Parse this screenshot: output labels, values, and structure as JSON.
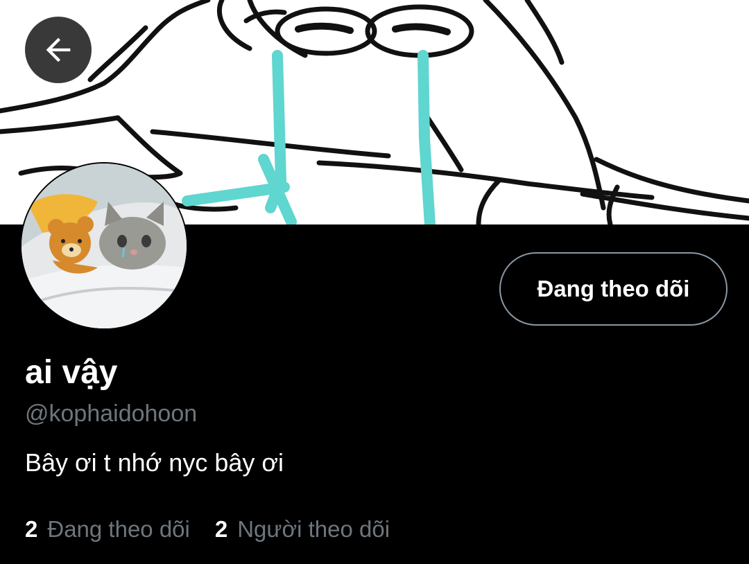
{
  "colors": {
    "background": "#000000",
    "text_primary": "#ffffff",
    "text_secondary": "#6e767d",
    "button_border": "#8b98a5",
    "banner_tears": "#5fd6cf"
  },
  "banner": {
    "icon": "crying-drawing-banner"
  },
  "back_button": {
    "icon": "arrow-left-icon"
  },
  "avatar": {
    "icon": "crying-cat-avatar"
  },
  "follow_button": {
    "label": "Đang theo dõi"
  },
  "profile": {
    "display_name": "ai vậy",
    "handle": "@kophaidohoon",
    "bio": "Bây ơi t nhớ nyc bây ơi"
  },
  "stats": {
    "following_count": "2",
    "following_label": "Đang theo dõi",
    "followers_count": "2",
    "followers_label": "Người theo dõi"
  }
}
